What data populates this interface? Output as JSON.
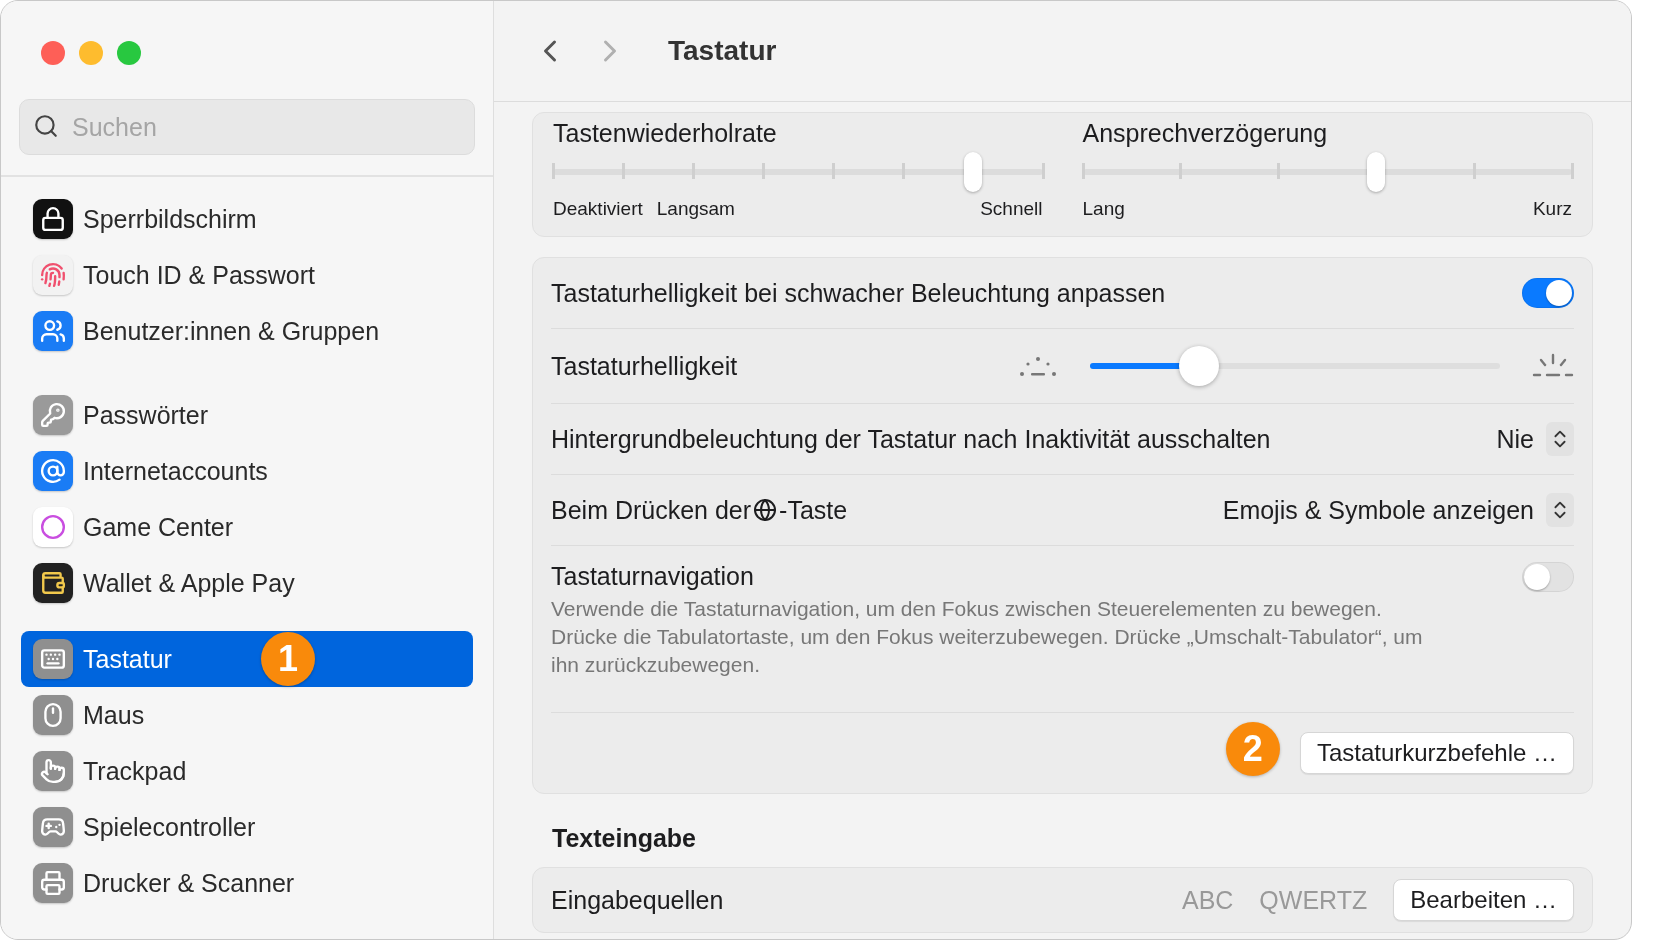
{
  "window": {
    "title": "Tastatur"
  },
  "search": {
    "placeholder": "Suchen"
  },
  "sidebar": {
    "groups": [
      {
        "items": [
          {
            "label": "Sperrbildschirm",
            "selected": false
          },
          {
            "label": "Touch ID & Passwort",
            "selected": false
          },
          {
            "label": "Benutzer:innen & Gruppen",
            "selected": false
          }
        ]
      },
      {
        "items": [
          {
            "label": "Passwörter",
            "selected": false
          },
          {
            "label": "Internetaccounts",
            "selected": false
          },
          {
            "label": "Game Center",
            "selected": false
          },
          {
            "label": "Wallet & Apple Pay",
            "selected": false
          }
        ]
      },
      {
        "items": [
          {
            "label": "Tastatur",
            "selected": true,
            "callout": "1"
          },
          {
            "label": "Maus",
            "selected": false
          },
          {
            "label": "Trackpad",
            "selected": false
          },
          {
            "label": "Spielecontroller",
            "selected": false
          },
          {
            "label": "Drucker & Scanner",
            "selected": false
          }
        ]
      }
    ]
  },
  "repeat_card": {
    "sliders": [
      {
        "title": "Tastenwiederholrate",
        "level": 0.857,
        "labels_left": [
          "Deaktiviert",
          "Langsam"
        ],
        "label_right": "Schnell"
      },
      {
        "title": "Ansprechverzögerung",
        "level": 0.6,
        "labels_left": [
          "Lang"
        ],
        "label_right": "Kurz"
      }
    ]
  },
  "settings_card": {
    "rows": [
      {
        "kind": "toggle",
        "label": "Tastaturhelligkeit bei schwacher Beleuchtung anpassen",
        "on": true
      },
      {
        "kind": "slider",
        "label": "Tastaturhelligkeit",
        "level": 0.265
      },
      {
        "kind": "popup",
        "label": "Hintergrundbeleuchtung der Tastatur nach Inaktivität ausschalten",
        "value": "Nie"
      },
      {
        "kind": "popup-globe",
        "label_before": "Beim Drücken der",
        "label_after": "-Taste",
        "value": "Emojis & Symbole anzeigen"
      },
      {
        "kind": "toggle",
        "label": "Tastaturnavigation",
        "on": false,
        "description": "Verwende die Tastaturnavigation, um den Fokus zwischen Steuerelementen zu bewegen. Drücke die Tabulatortaste, um den Fokus weiterzubewegen. Drücke „Umschalt-Tabulator“, um ihn zurückzubewegen."
      }
    ],
    "button": {
      "label": "Tastaturkurzbefehle …",
      "callout": "2"
    }
  },
  "text_input": {
    "heading": "Texteingabe",
    "row": {
      "label": "Eingabequellen",
      "values": [
        "ABC",
        "QWERTZ"
      ],
      "button": "Bearbeiten …"
    }
  }
}
